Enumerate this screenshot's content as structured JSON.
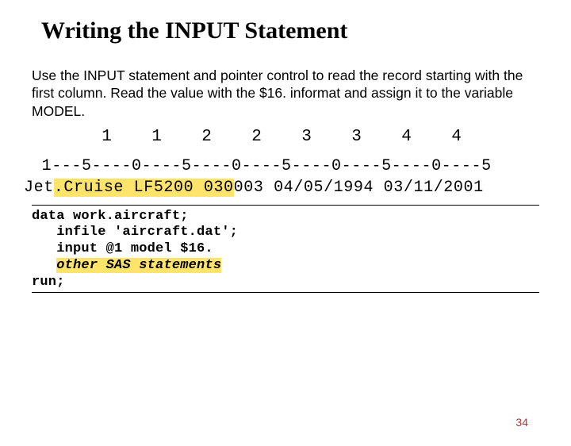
{
  "title": "Writing the INPUT Statement",
  "paragraph": "Use the INPUT statement and pointer control to read the record starting with the first column. Read the value with the $16. informat and assign it to the variable MODEL.",
  "ruler_tens": "       1    1    2    2    3    3    4    4",
  "ruler_units": " 1---5----0----5----0----5----0----5----0----5",
  "data_pre": "Jet",
  "data_hl1": ".Cruise LF5200 030",
  "data_rest": "003 04/05/1994 03/11/2001",
  "code_l1": "data work.aircraft;",
  "code_l2": "   infile 'aircraft.dat';",
  "code_l3": "   input @1 model $16.",
  "code_l4_plain": "   ",
  "code_l4_hl": "other SAS statements",
  "code_l5": "run;",
  "page": "34"
}
